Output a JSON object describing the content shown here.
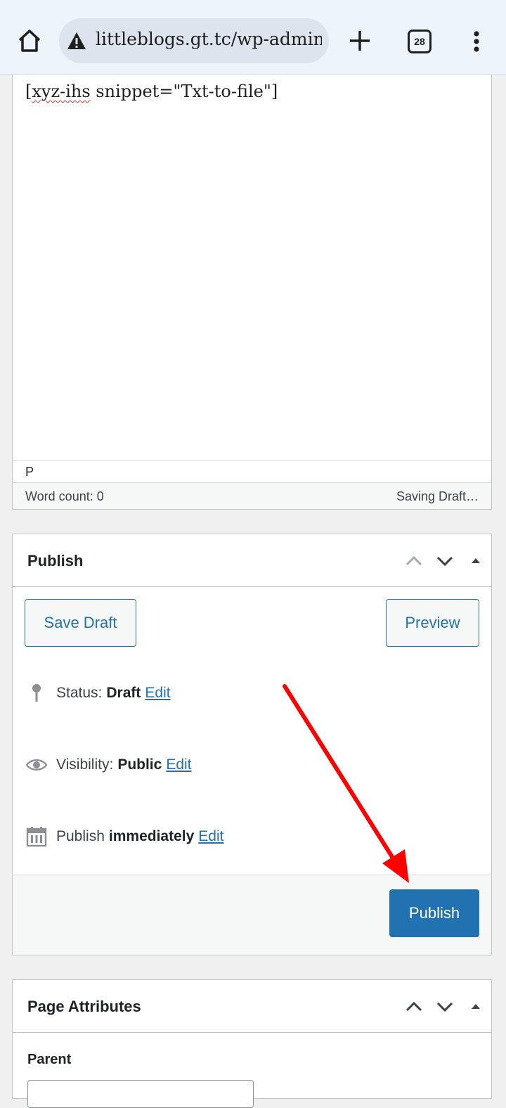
{
  "browser": {
    "url": "littleblogs.gt.tc/wp-admin/",
    "tab_count": "28"
  },
  "editor": {
    "content_prefix": "[",
    "content_misspelled": "xyz-ihs",
    "content_rest": " snippet=\"Txt-to-file\"]",
    "path": "P",
    "word_count": "Word count: 0",
    "save_status": "Saving Draft…"
  },
  "publish": {
    "title": "Publish",
    "save_draft_label": "Save Draft",
    "preview_label": "Preview",
    "status_label": "Status:",
    "status_value": "Draft",
    "visibility_label": "Visibility:",
    "visibility_value": "Public",
    "schedule_label": "Publish",
    "schedule_value": "immediately",
    "edit_label": "Edit",
    "publish_label": "Publish"
  },
  "page_attributes": {
    "title": "Page Attributes",
    "parent_label": "Parent"
  },
  "icons": {
    "home": "home-icon",
    "warning": "warning-icon",
    "new_tab": "plus-icon",
    "menu": "more-vert-icon",
    "status": "pin-icon",
    "visibility": "eye-icon",
    "schedule": "calendar-icon",
    "move_up": "chevron-up-icon",
    "move_down": "chevron-down-icon",
    "toggle": "triangle-up-icon"
  },
  "colors": {
    "accent": "#2271b1",
    "annotation_arrow": "#ff0000"
  }
}
